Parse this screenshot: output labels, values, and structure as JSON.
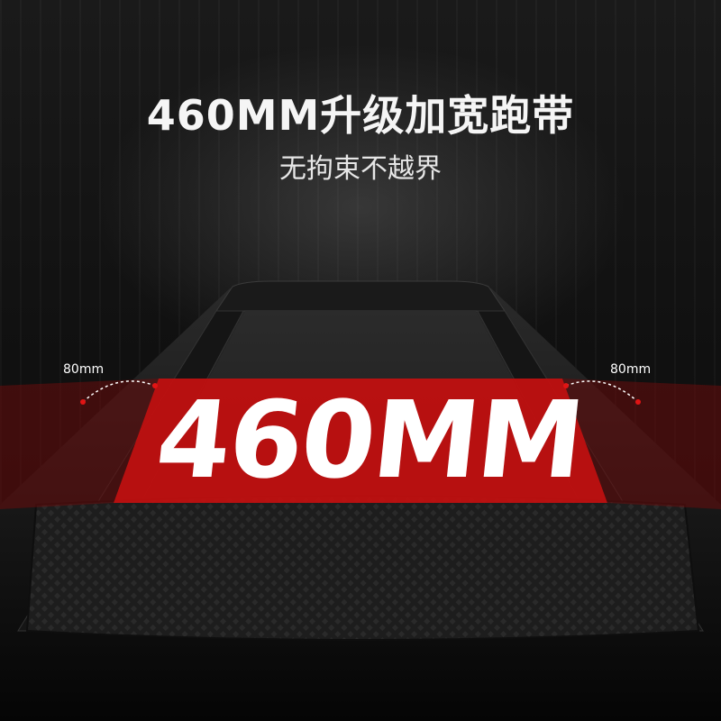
{
  "headline": "460MM升级加宽跑带",
  "subheadline": "无拘束不越界",
  "belt_width_label": "460MM",
  "side_margin_left": "80mm",
  "side_margin_right": "80mm",
  "colors": {
    "background": "#0b0b0b",
    "accent_red": "#c01010",
    "belt": "#1f1f1f",
    "text": "#ffffff"
  }
}
